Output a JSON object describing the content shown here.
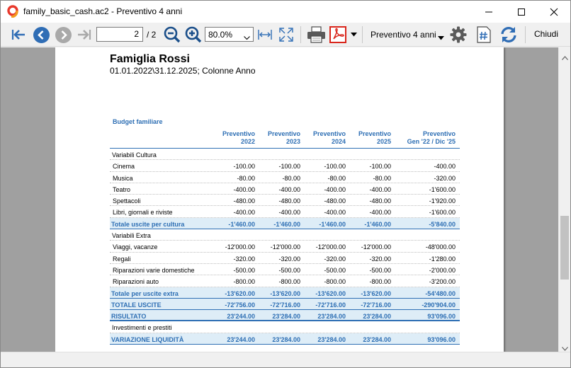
{
  "window": {
    "title": "family_basic_cash.ac2 - Preventivo 4 anni"
  },
  "toolbar": {
    "page_value": "2",
    "page_total": "/ 2",
    "zoom_value": "80.0%",
    "layout_value": "Preventivo 4 anni",
    "close_label": "Chiudi"
  },
  "report": {
    "title": "Famiglia Rossi",
    "subtitle": "01.01.2022\\31.12.2025; Colonne Anno",
    "table_title": "Budget familiare",
    "headers": [
      {
        "line1": "Preventivo",
        "line2": "2022"
      },
      {
        "line1": "Preventivo",
        "line2": "2023"
      },
      {
        "line1": "Preventivo",
        "line2": "2024"
      },
      {
        "line1": "Preventivo",
        "line2": "2025"
      },
      {
        "line1": "Preventivo",
        "line2": "Gen '22 / Dic '25"
      }
    ],
    "rows": [
      {
        "type": "group",
        "label": "Variabili Cultura",
        "values": [
          "",
          "",
          "",
          "",
          ""
        ]
      },
      {
        "type": "item",
        "label": "Cinema",
        "values": [
          "-100.00",
          "-100.00",
          "-100.00",
          "-100.00",
          "-400.00"
        ]
      },
      {
        "type": "item",
        "label": "Musica",
        "values": [
          "-80.00",
          "-80.00",
          "-80.00",
          "-80.00",
          "-320.00"
        ]
      },
      {
        "type": "item",
        "label": "Teatro",
        "values": [
          "-400.00",
          "-400.00",
          "-400.00",
          "-400.00",
          "-1'600.00"
        ]
      },
      {
        "type": "item",
        "label": "Spettacoli",
        "values": [
          "-480.00",
          "-480.00",
          "-480.00",
          "-480.00",
          "-1'920.00"
        ]
      },
      {
        "type": "item",
        "label": "Libri, giornali e riviste",
        "values": [
          "-400.00",
          "-400.00",
          "-400.00",
          "-400.00",
          "-1'600.00"
        ]
      },
      {
        "type": "total",
        "label": "Totale uscite per cultura",
        "values": [
          "-1'460.00",
          "-1'460.00",
          "-1'460.00",
          "-1'460.00",
          "-5'840.00"
        ]
      },
      {
        "type": "group",
        "label": "Variabili Extra",
        "values": [
          "",
          "",
          "",
          "",
          ""
        ]
      },
      {
        "type": "item",
        "label": "Viaggi, vacanze",
        "values": [
          "-12'000.00",
          "-12'000.00",
          "-12'000.00",
          "-12'000.00",
          "-48'000.00"
        ]
      },
      {
        "type": "item",
        "label": "Regali",
        "values": [
          "-320.00",
          "-320.00",
          "-320.00",
          "-320.00",
          "-1'280.00"
        ]
      },
      {
        "type": "item",
        "label": "Riparazioni varie domestiche",
        "values": [
          "-500.00",
          "-500.00",
          "-500.00",
          "-500.00",
          "-2'000.00"
        ]
      },
      {
        "type": "item",
        "label": "Riparazioni auto",
        "values": [
          "-800.00",
          "-800.00",
          "-800.00",
          "-800.00",
          "-3'200.00"
        ]
      },
      {
        "type": "total",
        "label": "Totale per uscite extra",
        "values": [
          "-13'620.00",
          "-13'620.00",
          "-13'620.00",
          "-13'620.00",
          "-54'480.00"
        ]
      },
      {
        "type": "total",
        "label": "TOTALE USCITE",
        "values": [
          "-72'756.00",
          "-72'716.00",
          "-72'716.00",
          "-72'716.00",
          "-290'904.00"
        ]
      },
      {
        "type": "total-big",
        "label": "RISULTATO",
        "values": [
          "23'244.00",
          "23'284.00",
          "23'284.00",
          "23'284.00",
          "93'096.00"
        ]
      },
      {
        "type": "group",
        "label": "Investimenti e prestiti",
        "values": [
          "",
          "",
          "",
          "",
          ""
        ]
      },
      {
        "type": "total",
        "label": "VARIAZIONE LIQUIDITÀ",
        "values": [
          "23'244.00",
          "23'284.00",
          "23'284.00",
          "23'284.00",
          "93'096.00"
        ]
      }
    ]
  },
  "colors": {
    "accent": "#2e6fb4",
    "total_fill": "#deedf7",
    "pdf_red": "#d9261c",
    "nav_blue": "#2f6db5"
  }
}
